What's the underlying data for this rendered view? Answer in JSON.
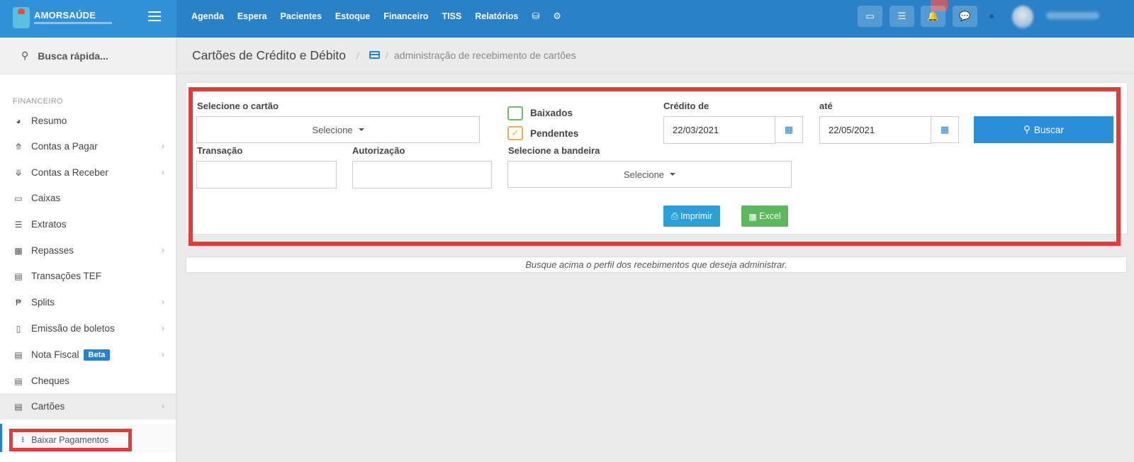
{
  "brand": {
    "name": "AMORSAÚDE"
  },
  "topnav": {
    "items": [
      "Agenda",
      "Espera",
      "Pacientes",
      "Estoque",
      "Financeiro",
      "TISS",
      "Relatórios"
    ],
    "icons": [
      "database-icon",
      "gear-icon"
    ]
  },
  "topbar_buttons": [
    "inbox-icon",
    "list-icon",
    "bell-icon",
    "chat-icon"
  ],
  "sidebar": {
    "search_label": "Busca rápida...",
    "section": "FINANCEIRO",
    "items": [
      {
        "label": "Resumo",
        "icon": "pie-chart-icon",
        "chevron": false
      },
      {
        "label": "Contas a Pagar",
        "icon": "arrow-up-circle-icon",
        "chevron": true
      },
      {
        "label": "Contas a Receber",
        "icon": "arrow-down-circle-icon",
        "chevron": true
      },
      {
        "label": "Caixas",
        "icon": "inbox-icon",
        "chevron": false
      },
      {
        "label": "Extratos",
        "icon": "list-icon",
        "chevron": false
      },
      {
        "label": "Repasses",
        "icon": "puzzle-icon",
        "chevron": true
      },
      {
        "label": "Transações TEF",
        "icon": "credit-card-icon",
        "chevron": false
      },
      {
        "label": "Splits",
        "icon": "split-icon",
        "chevron": true
      },
      {
        "label": "Emissão de boletos",
        "icon": "barcode-icon",
        "chevron": true
      },
      {
        "label": "Nota Fiscal",
        "icon": "file-icon",
        "chevron": true,
        "badge": "Beta"
      },
      {
        "label": "Cheques",
        "icon": "cheque-icon",
        "chevron": false
      },
      {
        "label": "Cartões",
        "icon": "credit-card-icon",
        "chevron": true
      }
    ],
    "sub_item": {
      "label": "Baixar Pagamentos",
      "icon": "download-icon"
    }
  },
  "page": {
    "title": "Cartões de Crédito e Débito",
    "breadcrumb": "administração de recebimento de cartões"
  },
  "filters": {
    "card_label": "Selecione o cartão",
    "card_value": "Selecione",
    "baixados_label": "Baixados",
    "baixados_checked": false,
    "pendentes_label": "Pendentes",
    "pendentes_checked": true,
    "credit_from_label": "Crédito de",
    "credit_from_value": "22/03/2021",
    "credit_to_label": "até",
    "credit_to_value": "22/05/2021",
    "search_button": "Buscar",
    "transaction_label": "Transação",
    "transaction_value": "",
    "authorization_label": "Autorização",
    "authorization_value": "",
    "brand_label": "Selecione a bandeira",
    "brand_value": "Selecione",
    "print_button": "Imprimir",
    "excel_button": "Excel"
  },
  "info_message": "Busque acima o perfil dos recebimentos que deseja administrar.",
  "colors": {
    "primary": "#2a81c8",
    "highlight": "#e53a3a",
    "excel": "#5cb85c"
  }
}
